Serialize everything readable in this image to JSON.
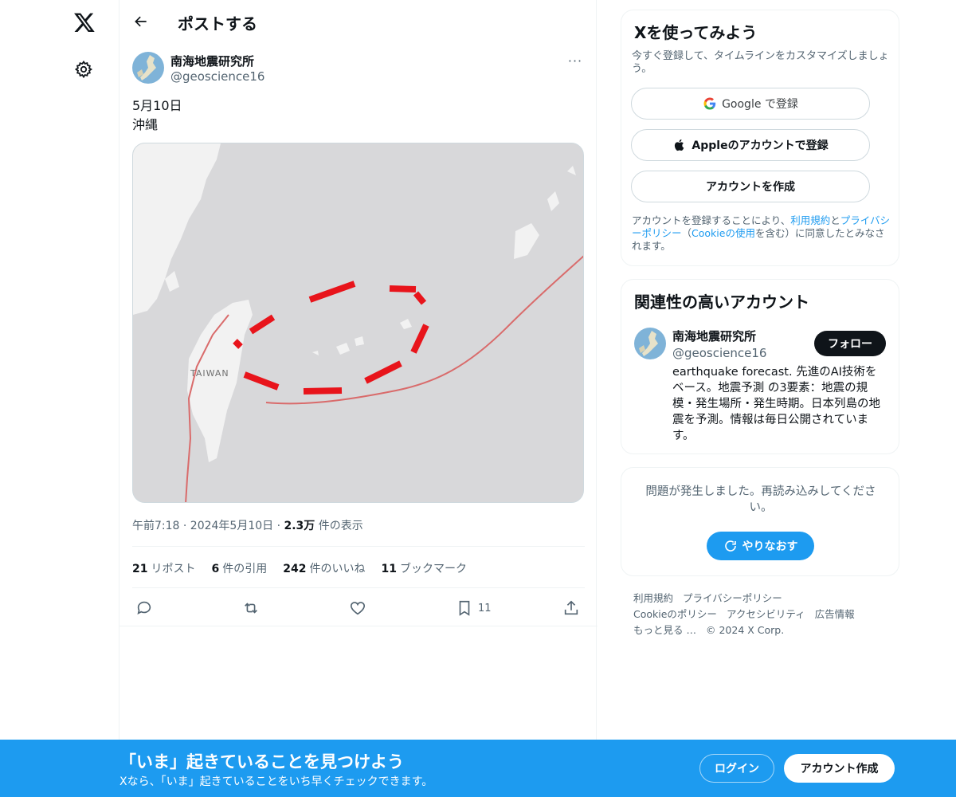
{
  "header": {
    "title": "ポストする"
  },
  "tweet": {
    "author_name": "南海地震研究所",
    "author_handle": "@geoscience16",
    "more": "···",
    "text_line1": "5月10日",
    "text_line2": "沖縄",
    "map_label": "TAIWAN",
    "time": "午前7:18 · 2024年5月10日 · ",
    "views_count": "2.3万",
    "views_label": " 件の表示",
    "stats": [
      {
        "count": "21",
        "label": "リポスト"
      },
      {
        "count": "6",
        "label": "件の引用"
      },
      {
        "count": "242",
        "label": "件のいいね"
      },
      {
        "count": "11",
        "label": "ブックマーク"
      }
    ],
    "bookmark_count": "11"
  },
  "signup_card": {
    "title": "Xを使ってみよう",
    "subtitle": "今すぐ登録して、タイムラインをカスタマイズしましょう。",
    "google_prefix": "Google",
    "google_suffix": " で登録",
    "apple_label": "Appleのアカウントで登録",
    "create_label": "アカウントを作成",
    "legal_1": "アカウントを登録することにより、",
    "legal_terms": "利用規約",
    "legal_2": "と",
    "legal_privacy": "プライバシーポリシー",
    "legal_3": "（",
    "legal_cookie": "Cookieの使用",
    "legal_4": "を含む）に同意したとみなされます。"
  },
  "related_card": {
    "title": "関連性の高いアカウント",
    "name": "南海地震研究所",
    "handle": "@geoscience16",
    "follow_label": "フォロー",
    "bio": "earthquake forecast. 先進のAI技術をベース。地震予測 の3要素：地震の規模・発生場所・発生時期。日本列島の地震を予測。情報は毎日公開されています。"
  },
  "error_card": {
    "message": "問題が発生しました。再読み込みしてください。",
    "retry_label": "やりなおす"
  },
  "footer": {
    "links": [
      "利用規約",
      "プライバシーポリシー",
      "Cookieのポリシー",
      "アクセシビリティ",
      "広告情報",
      "もっと見る …",
      "© 2024 X Corp."
    ]
  },
  "bottom_bar": {
    "title": "「いま」起きていることを見つけよう",
    "subtitle": "Xなら、「いま」起きていることをいち早くチェックできます。",
    "login_label": "ログイン",
    "signup_label": "アカウント作成"
  },
  "colors": {
    "accent": "#1d9bf0",
    "text": "#0f1419",
    "muted": "#536471",
    "map_marker": "#e8141b"
  },
  "icons": [
    "x-logo-icon",
    "gear-icon",
    "back-arrow-icon",
    "more-icon",
    "reply-icon",
    "repost-icon",
    "like-icon",
    "bookmark-icon",
    "share-icon",
    "google-icon",
    "apple-icon",
    "refresh-icon"
  ]
}
